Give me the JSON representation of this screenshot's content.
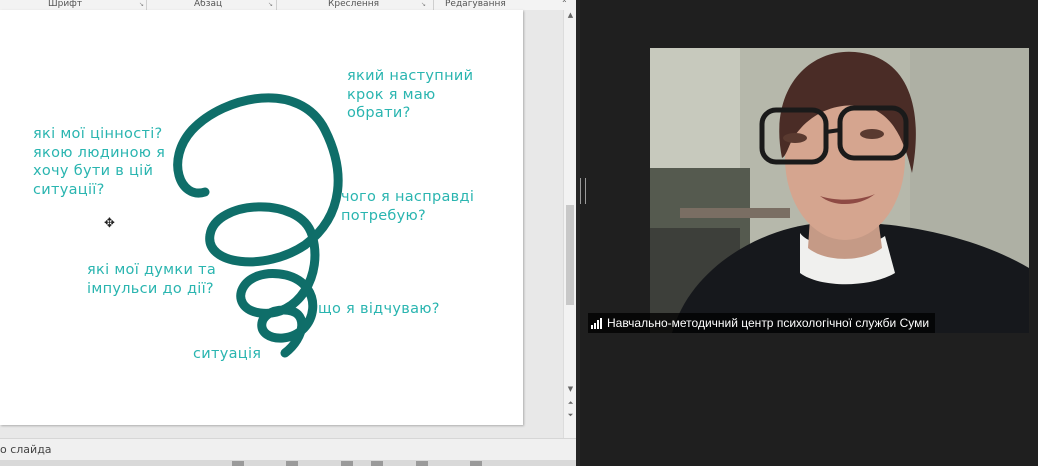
{
  "ribbon": {
    "groups": [
      "Шрифт",
      "Абзац",
      "Креслення",
      "Редагування"
    ]
  },
  "slide": {
    "texts": {
      "next_step": "який наступний\nкрок я маю\nобрати?",
      "values": "які мої цінності?\nякою людиною я\nхочу бути в цій\nситуації?",
      "needs": "чого я насправді\nпотребую?",
      "thoughts": "які мої думки та\nімпульси до дії?",
      "feelings": "що я відчуваю?",
      "situation": "ситуація"
    },
    "spiral_color": "#0f6e69",
    "text_color": "#2ab5b0"
  },
  "notes_bar": {
    "label": "о слайда"
  },
  "video": {
    "participant_name": "Навчально-методичний центр психологічної служби Суми"
  }
}
